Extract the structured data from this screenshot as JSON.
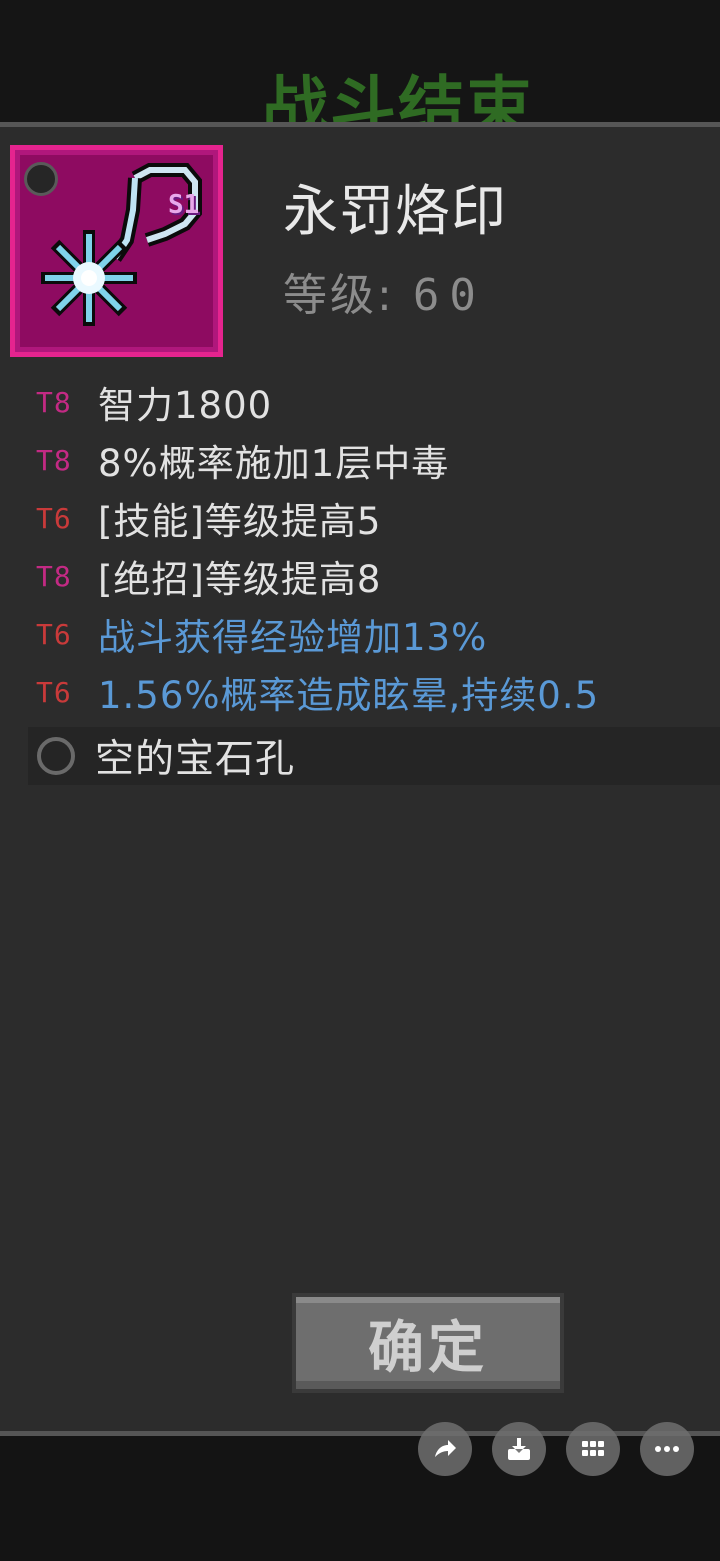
{
  "background": {
    "title": "战斗结束"
  },
  "item": {
    "name": "永罚烙印",
    "badge": "S1",
    "level_label": "等级:",
    "level_value": "60",
    "rarity_color": "#e5248f"
  },
  "affixes": [
    {
      "tier": "T8",
      "text": "智力1800",
      "style": "white"
    },
    {
      "tier": "T8",
      "text": "8%概率施加1层中毒",
      "style": "white"
    },
    {
      "tier": "T6",
      "text": "[技能]等级提高5",
      "style": "white"
    },
    {
      "tier": "T8",
      "text": "[绝招]等级提高8",
      "style": "white"
    },
    {
      "tier": "T6",
      "text": "战斗获得经验增加13%",
      "style": "blue"
    },
    {
      "tier": "T6",
      "text": "1.56%概率造成眩晕,持续0.5",
      "style": "blue"
    }
  ],
  "gem_slot": {
    "label": "空的宝石孔"
  },
  "confirm_button": {
    "label": "确定"
  },
  "share_actions": [
    {
      "icon": "share-icon"
    },
    {
      "icon": "download-icon"
    },
    {
      "icon": "grid-icon"
    },
    {
      "icon": "more-icon"
    }
  ]
}
